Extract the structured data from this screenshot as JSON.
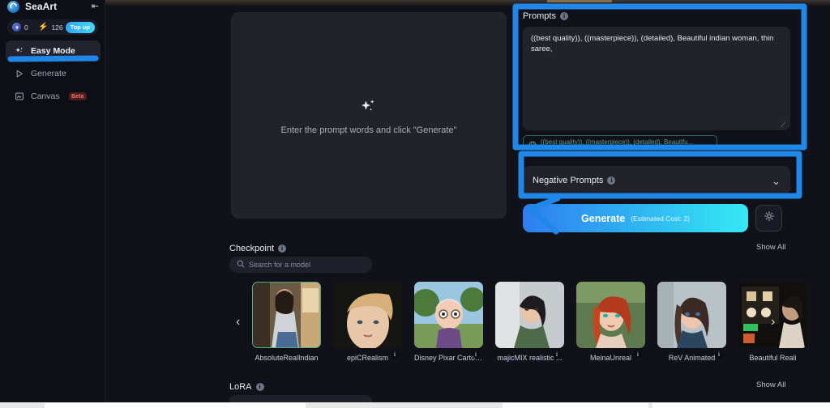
{
  "app": {
    "brand_name": "SeaArt",
    "logo_icon": "seaart-logo-icon",
    "collapse_icon": "panel-collapse-icon"
  },
  "credits": {
    "gem_icon": "gem-icon",
    "gem_value": "0",
    "bolt_icon": "lightning-bolt-icon",
    "bolt_value": "126",
    "topup_label": "Top up"
  },
  "sidebar": {
    "items": [
      {
        "label": "Easy Mode",
        "icon": "sparkle-icon",
        "active": true,
        "badge": ""
      },
      {
        "label": "Generate",
        "icon": "play-triangle-icon",
        "active": false,
        "badge": ""
      },
      {
        "label": "Canvas",
        "icon": "canvas-icon",
        "active": false,
        "badge": "Beta"
      }
    ]
  },
  "preview": {
    "icon": "sparkles-icon",
    "placeholder": "Enter the prompt words and click \"Generate\""
  },
  "prompts": {
    "title": "Prompts",
    "info_icon": "info-icon",
    "value": "((best quality)), ((masterpiece)), (detailed), Beautiful indian woman, thin saree,",
    "resize_icon": "resize-grip-icon",
    "chip": {
      "icon": "translate-globe-icon",
      "text": "((best quality)), ((masterpiece)), (detailed), Beautifu..."
    }
  },
  "negative_prompts": {
    "title": "Negative Prompts",
    "info_icon": "info-icon",
    "chevron_icon": "chevron-down-icon"
  },
  "generate": {
    "label": "Generate",
    "cost_label": "(Estimated Cost: 2)",
    "settings_icon": "gear-icon"
  },
  "checkpoint": {
    "title": "Checkpoint",
    "info_icon": "info-icon",
    "show_all_label": "Show All",
    "search": {
      "icon": "search-icon",
      "placeholder": "Search for a model"
    },
    "prev_icon": "chevron-left-icon",
    "next_icon": "chevron-right-icon",
    "models": [
      {
        "name": "AbsoluteRealIndian",
        "selected": true,
        "badge": ""
      },
      {
        "name": "epiCRealism",
        "selected": false,
        "badge": "i"
      },
      {
        "name": "Disney Pixar Cartoo...",
        "selected": false,
        "badge": "i"
      },
      {
        "name": "majicMIX realistic ...",
        "selected": false,
        "badge": "i"
      },
      {
        "name": "MeinaUnreal",
        "selected": false,
        "badge": "i"
      },
      {
        "name": "ReV Animated",
        "selected": false,
        "badge": "i"
      },
      {
        "name": "Beautiful Reali",
        "selected": false,
        "badge": ""
      }
    ]
  },
  "lora": {
    "title": "LoRA",
    "info_icon": "info-icon",
    "show_all_label": "Show All"
  },
  "colors": {
    "accent_blue": "#2e7df0",
    "accent_cyan": "#36e8f5",
    "annotation_blue": "#1e87e8",
    "selected_green": "#4caf7d",
    "beta_red": "#ff6b5e"
  }
}
